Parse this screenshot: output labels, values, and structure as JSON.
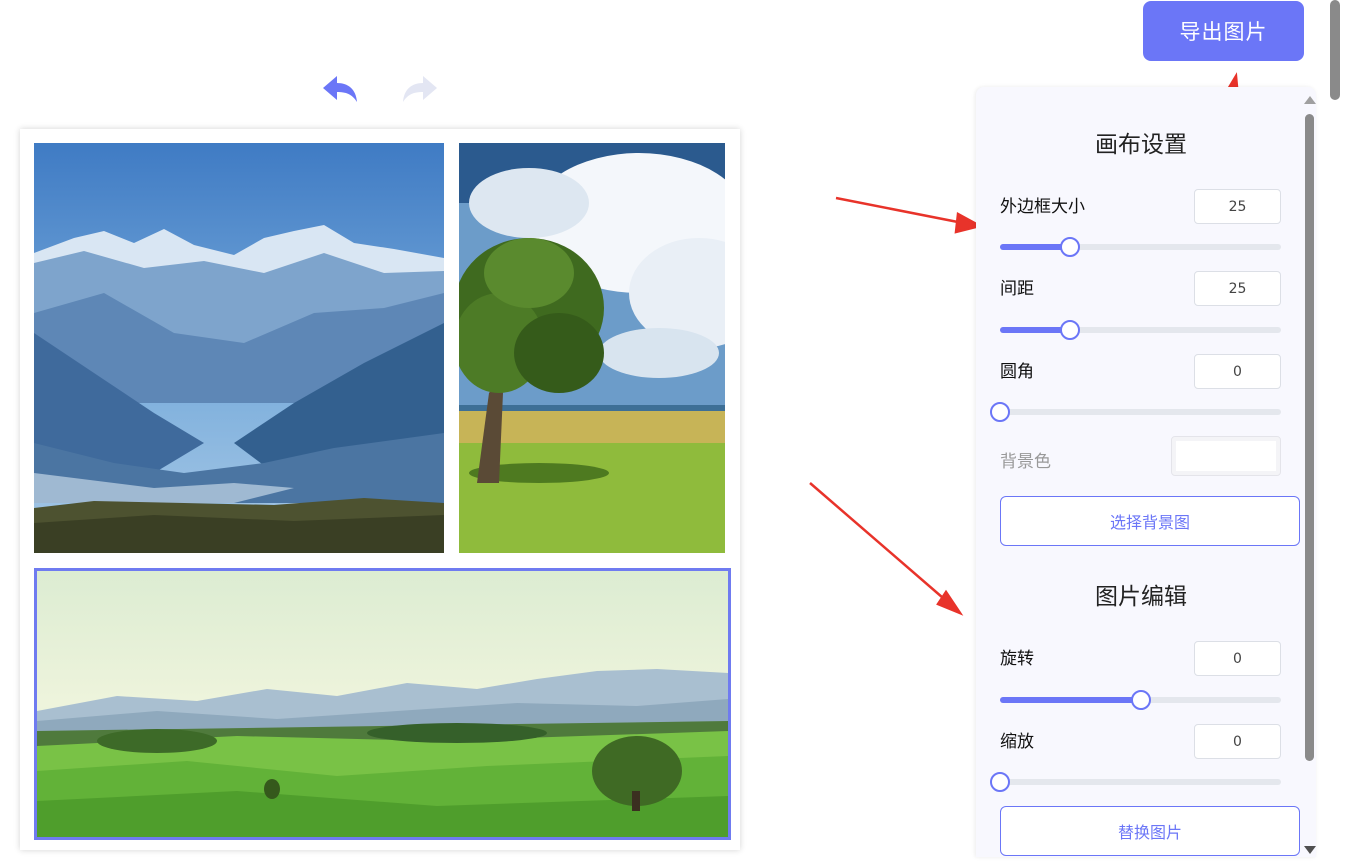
{
  "toolbar": {
    "export_label": "导出图片",
    "undo_icon": "undo-arrow-icon",
    "redo_icon": "redo-arrow-icon"
  },
  "colors": {
    "accent": "#6b76f7",
    "disabled_icon": "#e3e6f3",
    "arrow": "#e8332a",
    "selected_border": "#6f7bf0"
  },
  "canvas": {
    "photos": [
      {
        "name": "mountain-photo",
        "selected": false
      },
      {
        "name": "tree-photo",
        "selected": false
      },
      {
        "name": "meadow-photo",
        "selected": true
      }
    ]
  },
  "panel": {
    "canvas_settings": {
      "title": "画布设置",
      "border_size": {
        "label": "外边框大小",
        "value": "25",
        "slider_fraction": 0.25
      },
      "spacing": {
        "label": "间距",
        "value": "25",
        "slider_fraction": 0.25
      },
      "corner_radius": {
        "label": "圆角",
        "value": "0",
        "slider_fraction": 0.0
      },
      "background_color": {
        "label": "背景色",
        "value": "#ffffff"
      },
      "choose_background_button": "选择背景图"
    },
    "image_edit": {
      "title": "图片编辑",
      "rotate": {
        "label": "旋转",
        "value": "0",
        "slider_fraction": 0.5
      },
      "zoom": {
        "label": "缩放",
        "value": "0",
        "slider_fraction": 0.0
      },
      "replace_button": "替换图片"
    }
  }
}
